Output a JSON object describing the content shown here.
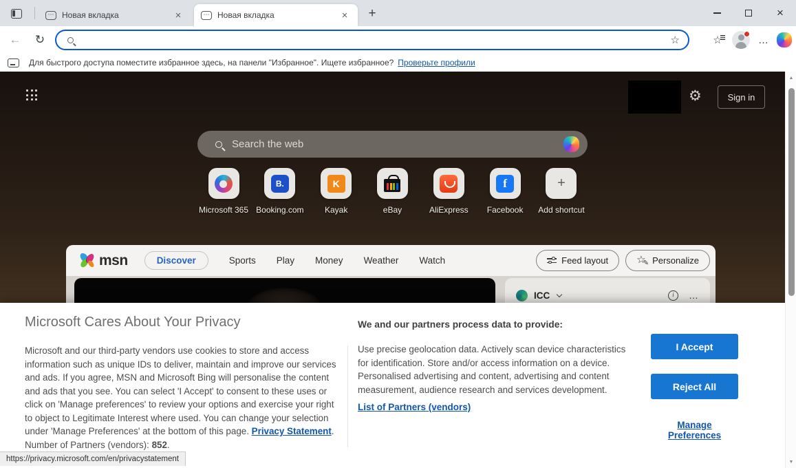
{
  "icons": {
    "dots": "⋯",
    "close": "×",
    "plus": "+",
    "back": "←",
    "refresh": "↻",
    "star": "☆",
    "more": "…",
    "gear": "⚙",
    "info_i": "i",
    "widget_more": "…",
    "scroll_up": "▲",
    "scroll_down": "▼",
    "personalize_star": "☆",
    "personalize_pen": "✎"
  },
  "tabs": {
    "items": [
      {
        "title": "Новая вкладка"
      },
      {
        "title": "Новая вкладка"
      }
    ]
  },
  "toolbar": {
    "address_value": "",
    "address_placeholder": ""
  },
  "favorites_bar": {
    "message": "Для быстрого доступа поместите избранное здесь, на панели \"Избранное\". Ищете избранное?",
    "link_label": "Проверьте профили"
  },
  "msn": {
    "sign_in_label": "Sign in",
    "search_placeholder": "Search the web",
    "shortcuts": [
      {
        "label": "Microsoft 365",
        "glyph": ""
      },
      {
        "label": "Booking.com",
        "glyph": "B."
      },
      {
        "label": "Kayak",
        "glyph": "K"
      },
      {
        "label": "eBay",
        "glyph": ""
      },
      {
        "label": "AliExpress",
        "glyph": ""
      },
      {
        "label": "Facebook",
        "glyph": "f"
      },
      {
        "label": "Add shortcut",
        "glyph": "+"
      }
    ],
    "logo_text": "msn",
    "nav_items": [
      "Discover",
      "Sports",
      "Play",
      "Money",
      "Weather",
      "Watch"
    ],
    "active_nav_item": "Discover",
    "feed_layout_label": "Feed layout",
    "personalize_label": "Personalize",
    "widget_title": "ICC"
  },
  "dialog": {
    "title": "Microsoft Cares About Your Privacy",
    "body_text": "Microsoft and our third-party vendors use cookies to store and access information such as unique IDs to deliver, maintain and improve our services and ads. If you agree, MSN and Microsoft Bing will personalise the content and ads that you see. You can select 'I Accept' to consent to these uses or click on 'Manage preferences' to review your options and exercise your right to object to Legitimate Interest where used.  You can change your selection under 'Manage Preferences' at the bottom of this page. ",
    "privacy_statement_link": "Privacy Statement",
    "after_privacy_link": ".",
    "partners_label": "Number of Partners (vendors): ",
    "partners_count": "852",
    "partners_suffix": ".",
    "providers_heading": "We and our partners process data to provide:",
    "providers_body": "Use precise geolocation data. Actively scan device characteristics for identification. Store and/or access information on a device. Personalised advertising and content, advertising and content measurement, audience research and services development.",
    "partners_list_link": "List of Partners (vendors)",
    "accept_label": "I Accept",
    "reject_label": "Reject All",
    "manage_label": "Manage Preferences"
  },
  "status_bar": {
    "url": "https://privacy.microsoft.com/en/privacystatement"
  },
  "colors": {
    "accent_blue": "#1776d2",
    "link_blue": "#1156ad",
    "address_border": "#0b57cf",
    "tabbar_bg": "#dee1e6"
  }
}
